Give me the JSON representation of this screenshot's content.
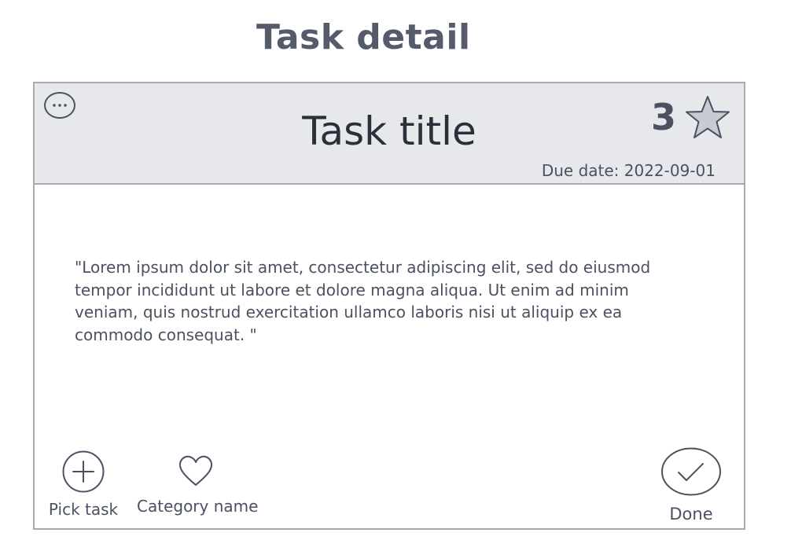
{
  "page": {
    "title": "Task detail"
  },
  "task": {
    "title": "Task title",
    "points": "3",
    "due_date": "Due date: 2022-09-01",
    "description": "\"Lorem ipsum dolor sit amet, consectetur adipiscing elit, sed do eiusmod tempor incididunt ut labore et dolore magna aliqua. Ut enim ad minim veniam, quis nostrud exercitation ullamco laboris nisi ut aliquip ex ea commodo consequat. \""
  },
  "actions": {
    "pick_task": {
      "label": "Pick task",
      "icon": "plus-circle-icon"
    },
    "category": {
      "label": "Category name",
      "icon": "heart-icon"
    },
    "done": {
      "label": "Done",
      "icon": "check-circle-icon"
    }
  },
  "icons": {
    "more": "more-horizontal-icon",
    "star": "star-icon"
  },
  "colors": {
    "header_bg": "#e7e8ec",
    "border": "#a7aab1",
    "text": "#4b5160",
    "star_fill": "#c9cbd2"
  }
}
